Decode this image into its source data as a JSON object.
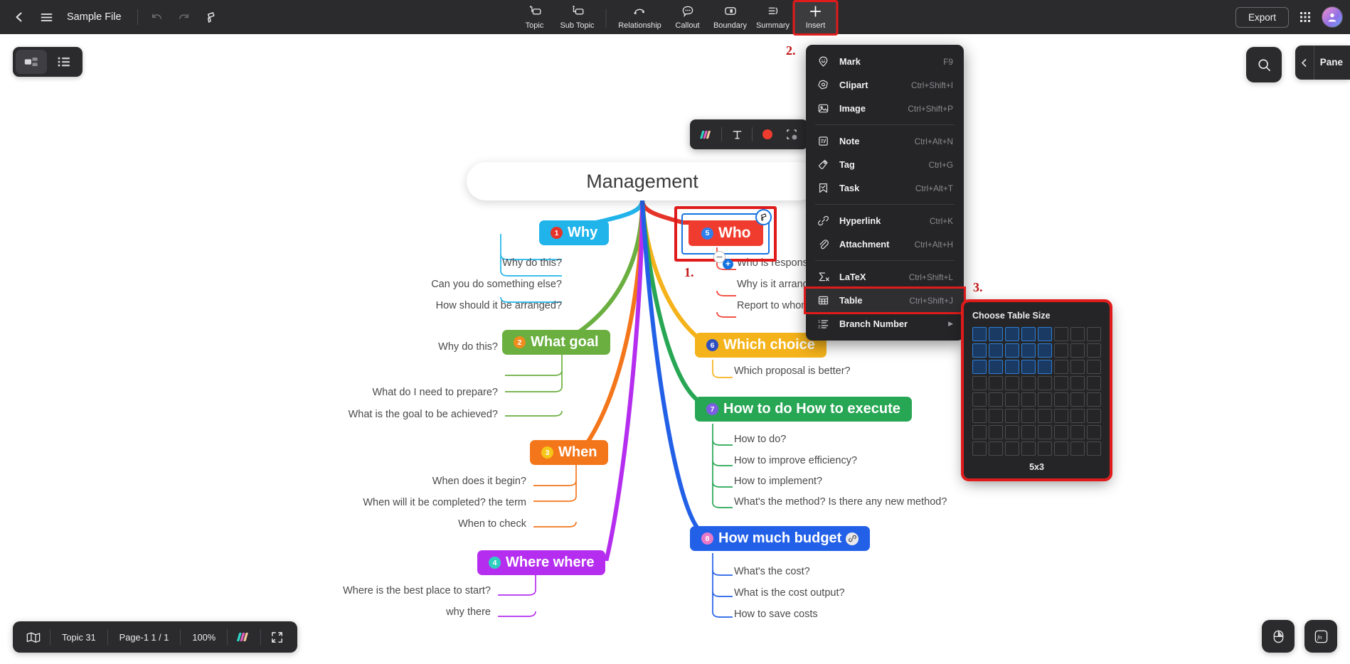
{
  "app": {
    "doc_title": "Sample File",
    "export_label": "Export"
  },
  "toolbar": {
    "tools": [
      {
        "label": "Topic",
        "icon": "topic-icon"
      },
      {
        "label": "Sub Topic",
        "icon": "sub-topic-icon"
      },
      {
        "label": "Relationship",
        "icon": "relationship-icon"
      },
      {
        "label": "Callout",
        "icon": "callout-icon"
      },
      {
        "label": "Boundary",
        "icon": "boundary-icon"
      },
      {
        "label": "Summary",
        "icon": "summary-icon"
      },
      {
        "label": "Insert",
        "icon": "plus-icon"
      }
    ]
  },
  "insert_menu": {
    "items": [
      {
        "label": "Mark",
        "shortcut": "F9",
        "icon": "smiley-pin-icon"
      },
      {
        "label": "Clipart",
        "shortcut": "Ctrl+Shift+I",
        "icon": "clipart-icon"
      },
      {
        "label": "Image",
        "shortcut": "Ctrl+Shift+P",
        "icon": "image-icon"
      },
      {
        "label": "Note",
        "shortcut": "Ctrl+Alt+N",
        "icon": "note-icon"
      },
      {
        "label": "Tag",
        "shortcut": "Ctrl+G",
        "icon": "tag-icon"
      },
      {
        "label": "Task",
        "shortcut": "Ctrl+Alt+T",
        "icon": "task-icon"
      },
      {
        "label": "Hyperlink",
        "shortcut": "Ctrl+K",
        "icon": "link-icon"
      },
      {
        "label": "Attachment",
        "shortcut": "Ctrl+Alt+H",
        "icon": "paperclip-icon"
      },
      {
        "label": "LaTeX",
        "shortcut": "Ctrl+Shift+L",
        "icon": "sigma-icon"
      },
      {
        "label": "Table",
        "shortcut": "Ctrl+Shift+J",
        "icon": "table-icon"
      },
      {
        "label": "Branch Number",
        "shortcut": "",
        "icon": "ordered-list-icon"
      }
    ]
  },
  "table_picker": {
    "title": "Choose Table Size",
    "cols": 8,
    "rows": 8,
    "selected_cols": 5,
    "selected_rows": 3,
    "size_label": "5x3",
    "selected_color": "#1b3a63",
    "selected_border": "#2f7fd4"
  },
  "annotations": {
    "step1": "1.",
    "step2": "2.",
    "step3": "3.",
    "color": "#c01414"
  },
  "right_panel": {
    "title": "Pane"
  },
  "statusbar": {
    "topic_count": "Topic 31",
    "page": "Page-1  1 / 1",
    "zoom": "100%"
  },
  "mindmap": {
    "root": {
      "label": "Management"
    },
    "branches": [
      {
        "num": "1",
        "label": "Why",
        "color": "#21b4ea",
        "num_bg": "#e63329",
        "side": "left",
        "children": [
          "Why do this?",
          "Can you do something else?",
          "How should it be arranged?"
        ]
      },
      {
        "num": "2",
        "label": "What goal",
        "color": "#6aaf3f",
        "num_bg": "#f08c1e",
        "side": "left",
        "children": [
          "Why do this?",
          "What do I need to prepare?",
          "What is the goal to be achieved?"
        ]
      },
      {
        "num": "3",
        "label": "When",
        "color": "#f4761b",
        "num_bg": "#f5c518",
        "side": "left",
        "children": [
          "When does it begin?",
          "When will it be completed? the term",
          "When to check"
        ]
      },
      {
        "num": "4",
        "label": "Where where",
        "color": "#b52ef0",
        "num_bg": "#2ecfc0",
        "side": "left",
        "children": [
          "Where is the best place to start?",
          "why there"
        ]
      },
      {
        "num": "5",
        "label": "Who",
        "color": "#f03c2e",
        "num_bg": "#2f80ed",
        "side": "right",
        "selected": true,
        "children": [
          "Who is responsible?",
          "Why is it arranged?",
          "Report to whom?"
        ]
      },
      {
        "num": "6",
        "label": "Which choice",
        "color": "#f5b31b",
        "num_bg": "#2f4fc0",
        "side": "right",
        "children": [
          "Which proposal is better?"
        ]
      },
      {
        "num": "7",
        "label": "How to do How to execute",
        "color": "#27a654",
        "num_bg": "#7b5fe0",
        "side": "right",
        "children": [
          "How to do?",
          "How to improve efficiency?",
          "How to implement?",
          "What's the method? Is there any new method?"
        ]
      },
      {
        "num": "8",
        "label": "How much budget",
        "color": "#2360e8",
        "num_bg": "#e879c8",
        "side": "right",
        "has_link": true,
        "children": [
          "What's the cost?",
          "What is the cost output?",
          "How to save costs"
        ]
      }
    ]
  }
}
